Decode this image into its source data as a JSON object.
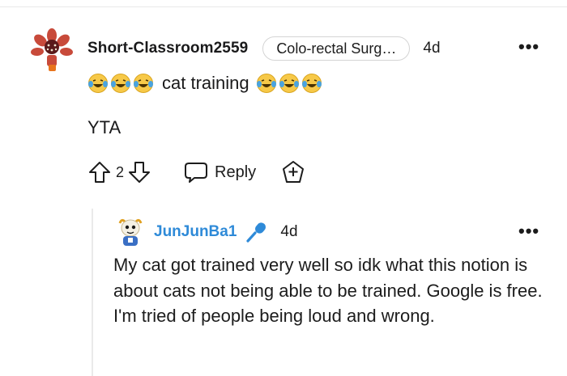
{
  "comment": {
    "username": "Short-Classroom2559",
    "flair": "Colo-rectal Surg…",
    "time": "4d",
    "line1_text": "cat training",
    "line2_text": "YTA",
    "vote_count": "2",
    "reply_label": "Reply",
    "more_label": "•••"
  },
  "reply": {
    "username": "JunJunBa1",
    "time": "4d",
    "body": "My cat got trained very well so idk what this notion is about cats not being able to be trained. Google is free. I'm tried of people being loud and wrong.",
    "more_label": "•••"
  },
  "colors": {
    "username_link": "#2e8ad8",
    "emoji_yellow": "#f7c948",
    "tear_blue": "#4aa3df",
    "text": "#1c1c1c"
  },
  "icons": [
    "avatar-demogorgon",
    "laughing-tears-emoji",
    "upvote-icon",
    "downvote-icon",
    "speech-bubble-icon",
    "award-icon",
    "microphone-icon",
    "avatar-cartoon"
  ]
}
